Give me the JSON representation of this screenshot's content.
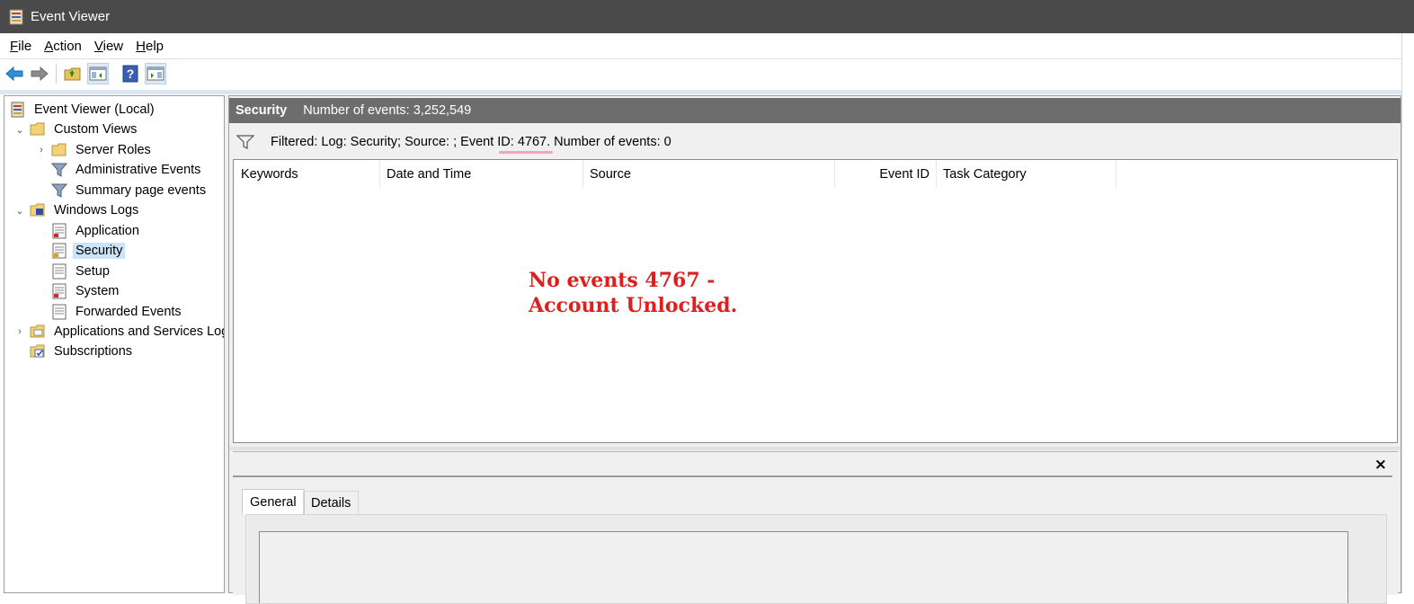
{
  "window": {
    "title": "Event Viewer"
  },
  "menu": {
    "file": "File",
    "action": "Action",
    "view": "View",
    "help": "Help"
  },
  "toolbar": {
    "icons": [
      "back-arrow-icon",
      "forward-arrow-icon",
      "open-folder-icon",
      "show-hide-console-tree-icon",
      "help-icon",
      "show-hide-action-pane-icon"
    ]
  },
  "tree": {
    "root": "Event Viewer (Local)",
    "custom_views": "Custom Views",
    "server_roles": "Server Roles",
    "administrative_events": "Administrative Events",
    "summary_page_events": "Summary page events",
    "windows_logs": "Windows Logs",
    "application": "Application",
    "security": "Security",
    "setup": "Setup",
    "system": "System",
    "forwarded_events": "Forwarded Events",
    "apps_services": "Applications and Services Logs",
    "subscriptions": "Subscriptions",
    "selected": "Security"
  },
  "main": {
    "header_title": "Security",
    "header_count": "Number of events: 3,252,549",
    "filter_text": "Filtered: Log: Security; Source: ; Event ID: 4767. Number of events: 0",
    "columns": [
      "Keywords",
      "Date and Time",
      "Source",
      "Event ID",
      "Task Category"
    ],
    "annotation_line1": "No events 4767 -",
    "annotation_line2": "Account Unlocked."
  },
  "preview": {
    "close": "×",
    "tabs": [
      "General",
      "Details"
    ],
    "active_tab": "General"
  },
  "colors": {
    "annotation": "#e01e1e",
    "header_bg": "#6d6d6d",
    "title_bg": "#4a4a4a",
    "selection": "#cce4f7"
  }
}
